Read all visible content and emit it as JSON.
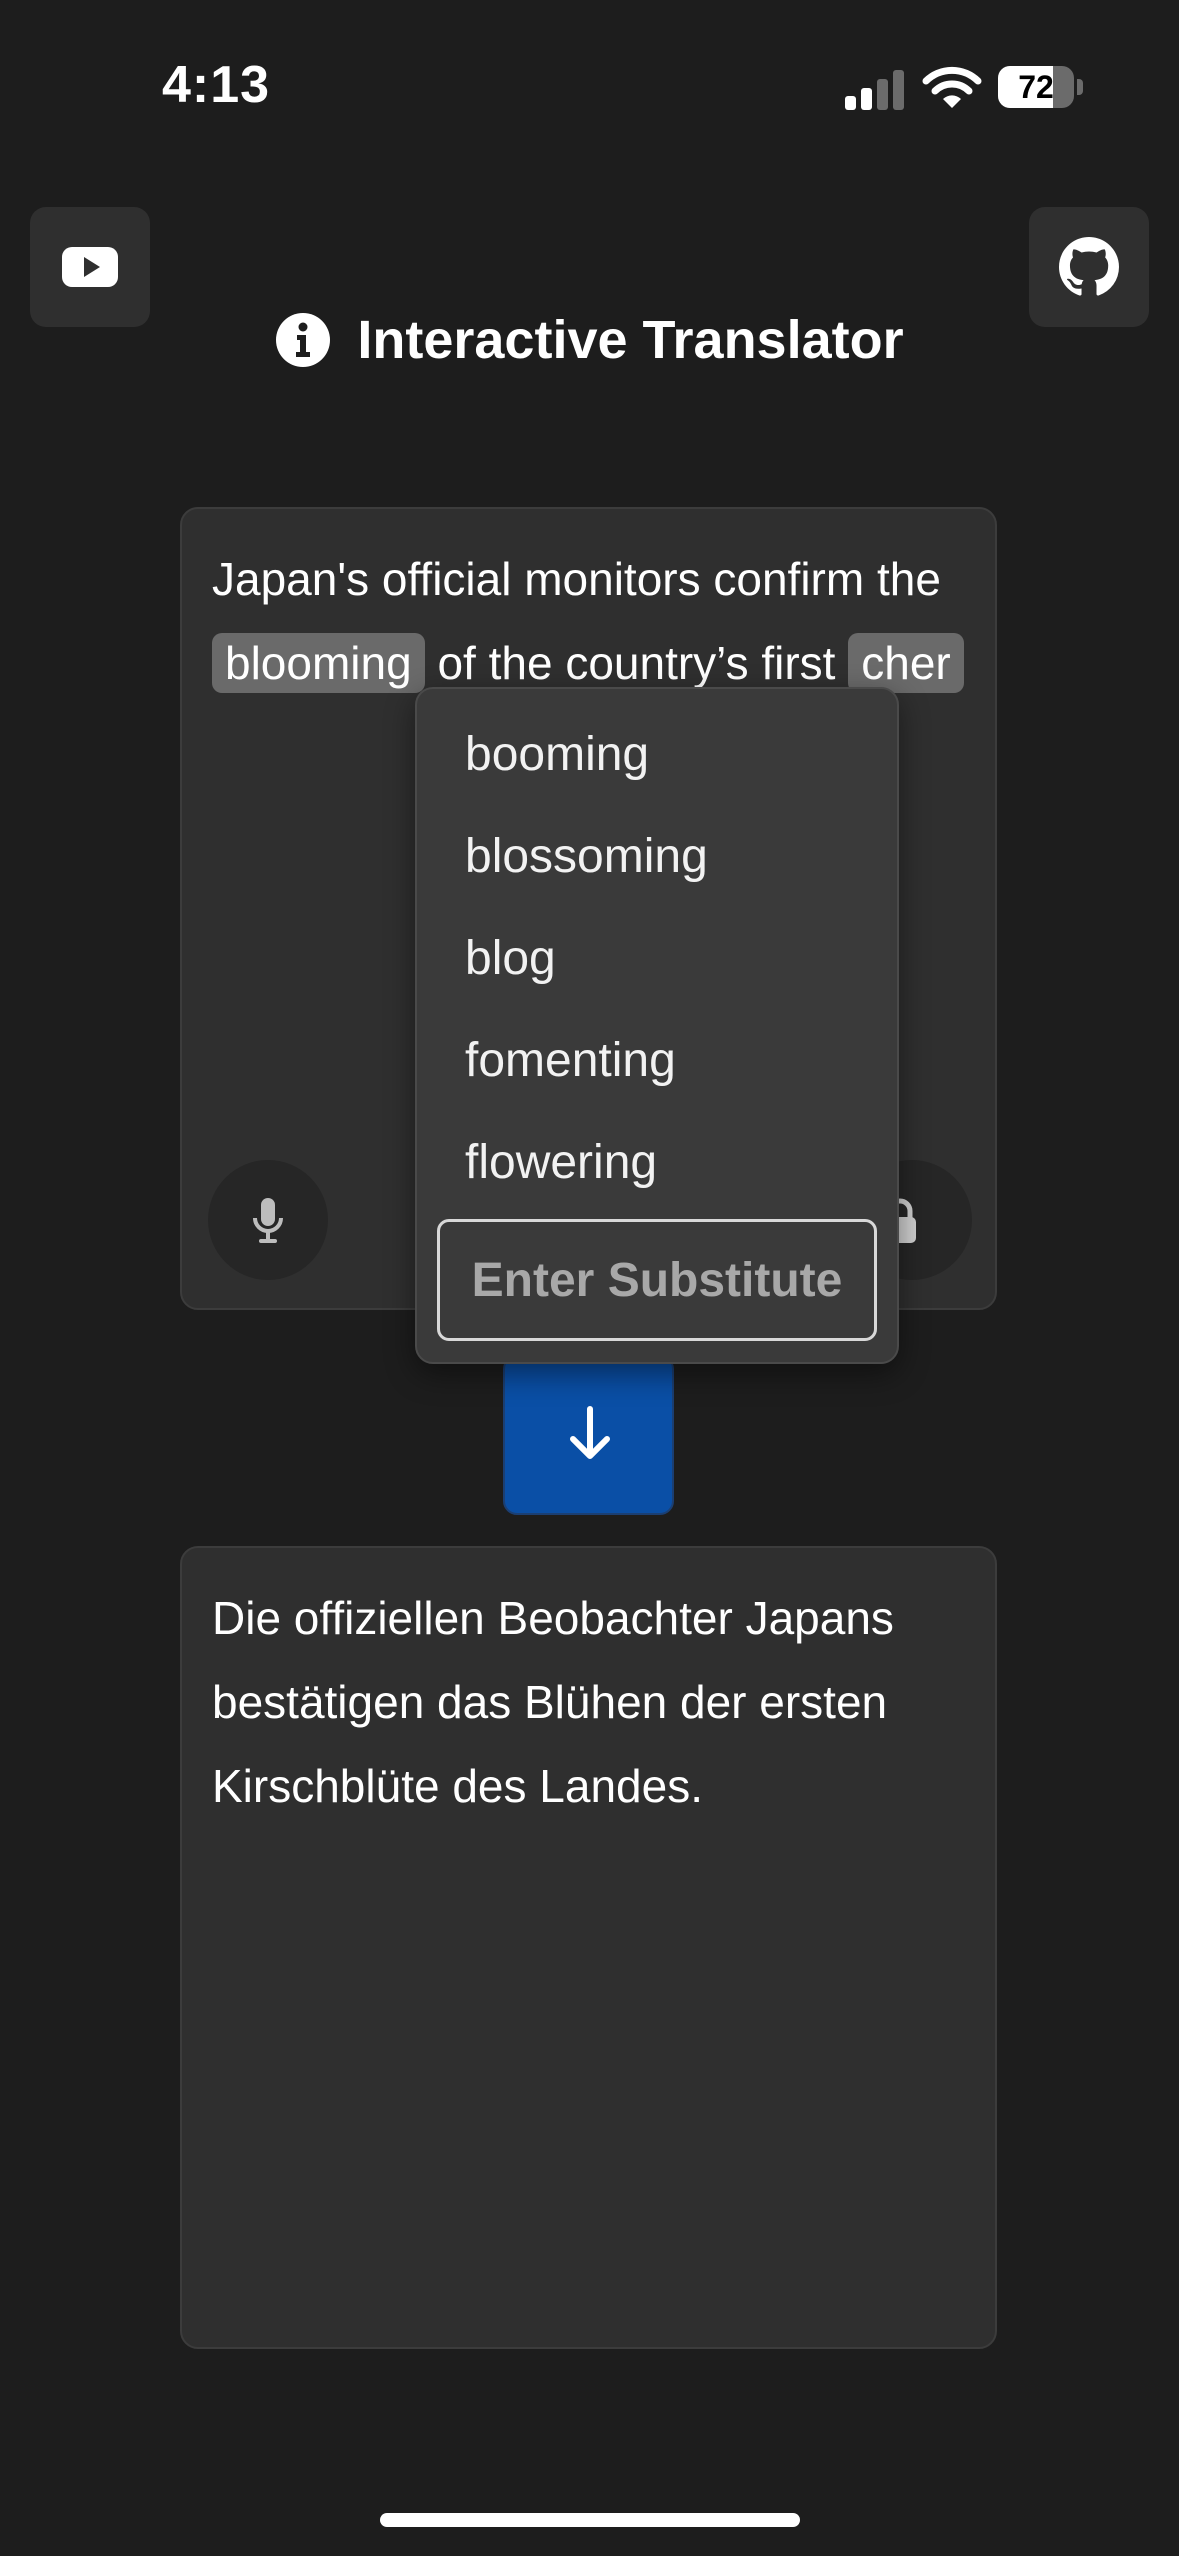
{
  "status_bar": {
    "time": "4:13",
    "battery_level": "72",
    "battery_fraction": 0.72,
    "signal_bars_active": 2,
    "signal_bars_total": 4
  },
  "header": {
    "title": "Interactive Translator"
  },
  "source": {
    "before_chip_1": "Japan's official monitors confirm the ",
    "chip_1": "blooming",
    "between_chips": " of the country’s first ",
    "chip_2": "cher"
  },
  "dropdown": {
    "options": [
      "booming",
      "blossoming",
      "blog",
      "fomenting",
      "flowering"
    ],
    "substitute_placeholder": "Enter Substitute"
  },
  "target": {
    "text": "Die offiziellen Beobachter Japans bestätigen das Blühen der ersten Kirschblüte des Landes."
  },
  "colors": {
    "background": "#1d1d1d",
    "panel": "#2f2f2f",
    "accent": "#0a4fa6",
    "chip": "#6a6a6a",
    "dropdown": "#3a3a3a"
  },
  "icons": [
    "youtube-icon",
    "github-icon",
    "info-icon",
    "microphone-icon",
    "lock-icon",
    "arrow-down-icon",
    "signal-icon",
    "wifi-icon",
    "battery-icon"
  ]
}
